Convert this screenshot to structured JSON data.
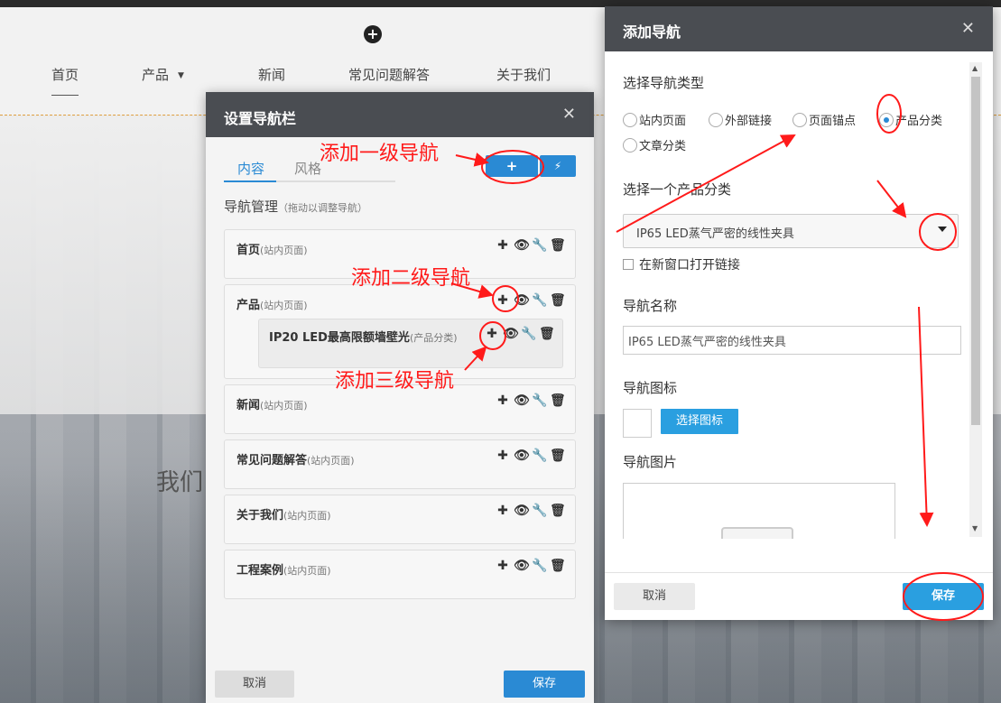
{
  "site": {
    "nav": [
      "首页",
      "产品",
      "新闻",
      "常见问题解答",
      "关于我们"
    ],
    "body_text": "我们"
  },
  "nav_dialog": {
    "title": "设置导航栏",
    "tabs": {
      "content": "内容",
      "style": "风格"
    },
    "management_title": "导航管理",
    "management_hint": "（拖动以调整导航）",
    "items": [
      {
        "name": "首页",
        "type": "(站内页面)"
      },
      {
        "name": "产品",
        "type": "(站内页面)"
      },
      {
        "name": "新闻",
        "type": "(站内页面)"
      },
      {
        "name": "常见问题解答",
        "type": "(站内页面)"
      },
      {
        "name": "关于我们",
        "type": "(站内页面)"
      },
      {
        "name": "工程案例",
        "type": "(站内页面)"
      }
    ],
    "sub_item": {
      "name": "IP20 LED最高限额墙壁光",
      "type": "(产品分类)"
    },
    "cancel": "取消",
    "save": "保存"
  },
  "add_dialog": {
    "title": "添加导航",
    "type_section": "选择导航类型",
    "types": [
      "站内页面",
      "外部链接",
      "页面锚点",
      "产品分类",
      "文章分类"
    ],
    "selected_type": "产品分类",
    "category_section": "选择一个产品分类",
    "category_value": "IP65 LED蒸气严密的线性夹具",
    "new_window_label": "在新窗口打开链接",
    "name_section": "导航名称",
    "name_value": "IP65 LED蒸气严密的线性夹具",
    "icon_section": "导航图标",
    "choose_icon": "选择图标",
    "image_section": "导航图片",
    "cancel": "取消",
    "save": "保存"
  },
  "annotations": {
    "add_level1": "添加一级导航",
    "add_level2": "添加二级导航",
    "add_level3": "添加三级导航"
  },
  "colors": {
    "accent": "#2a8ad4",
    "annotation": "#ff1a1a",
    "header": "#4a4d52"
  }
}
